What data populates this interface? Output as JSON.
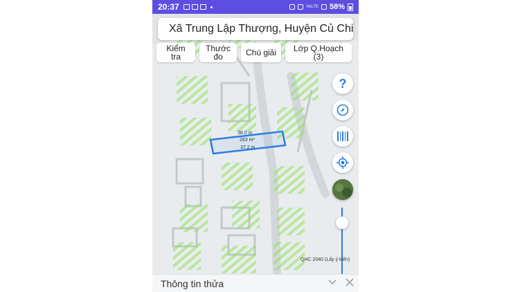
{
  "status_bar": {
    "time": "20:37",
    "battery": "58%",
    "network": "VoLTE"
  },
  "header": {
    "title": "Xã Trung Lập Thượng, Huyện Củ Chi"
  },
  "toolbar": {
    "check_label": "Kiểm tra",
    "measure_label": "Thước đo",
    "legend_label": "Chú giải",
    "layer_label": "Lớp Q.Hoạch (3)"
  },
  "map": {
    "plot_top_length": "38.0 m",
    "plot_area": "263 m²",
    "plot_bottom_length": "37.2 m",
    "plan_layer_label": "QHC 2040 (Lấy ý kiến)",
    "plan_opacity": 1.0
  },
  "side_buttons": {
    "help": "?",
    "compass_icon": "compass-icon",
    "barcode_icon": "barcode-icon",
    "locate_icon": "my-location-icon",
    "satellite_icon": "satellite-thumbnail"
  },
  "bottom_sheet": {
    "title": "Thông tin thửa"
  },
  "colors": {
    "status_bar": "#5b4ee0",
    "accent": "#2a7de1",
    "hatch_green": "#8ee35a"
  }
}
